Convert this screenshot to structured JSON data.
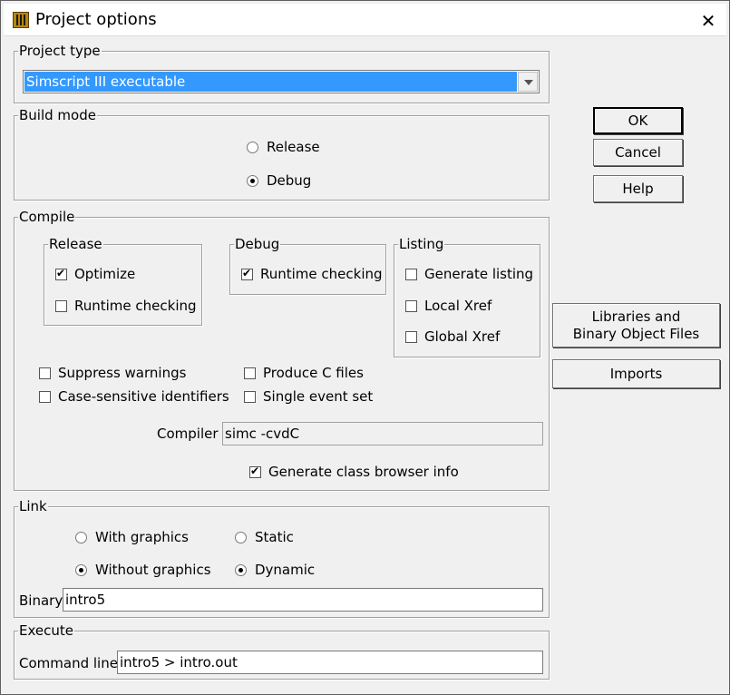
{
  "window": {
    "title": "Project options",
    "close_label": "✕"
  },
  "project_type": {
    "group_label": "Project type",
    "selected": "Simscript III executable"
  },
  "build_mode": {
    "group_label": "Build mode",
    "release_label": "Release",
    "debug_label": "Debug",
    "selected": "Debug"
  },
  "buttons": {
    "ok": "OK",
    "cancel": "Cancel",
    "help": "Help",
    "libraries": "Libraries and Binary Object Files",
    "imports": "Imports"
  },
  "compile": {
    "group_label": "Compile",
    "release": {
      "group_label": "Release",
      "optimize": "Optimize",
      "runtime": "Runtime checking",
      "optimize_checked": true,
      "runtime_checked": false
    },
    "debug": {
      "group_label": "Debug",
      "runtime": "Runtime checking",
      "runtime_checked": true
    },
    "listing": {
      "group_label": "Listing",
      "generate": "Generate listing",
      "local": "Local Xref",
      "global": "Global Xref"
    },
    "suppress_warnings": "Suppress warnings",
    "case_sensitive": "Case-sensitive identifiers",
    "produce_c": "Produce C files",
    "single_event": "Single event set",
    "compiler_label": "Compiler",
    "compiler_value": "simc -cvdC",
    "class_browser": "Generate class browser info",
    "class_browser_checked": true
  },
  "link": {
    "group_label": "Link",
    "with_graphics": "With graphics",
    "without_graphics": "Without graphics",
    "static": "Static",
    "dynamic": "Dynamic",
    "graphics_selected": "Without graphics",
    "linkage_selected": "Dynamic",
    "binary_label": "Binary",
    "binary_value": "intro5"
  },
  "execute": {
    "group_label": "Execute",
    "command_label": "Command line",
    "command_value": "intro5 > intro.out"
  }
}
